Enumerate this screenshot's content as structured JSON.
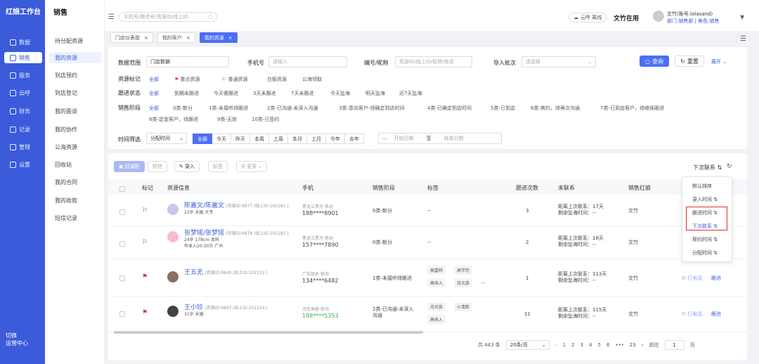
{
  "app": {
    "brand": "红娘工作台",
    "switch_label": "切换\n运营中心"
  },
  "leftnav": [
    {
      "label": "数据",
      "icon": "data-icon"
    },
    {
      "label": "销售",
      "icon": "sales-icon",
      "active": true
    },
    {
      "label": "服务",
      "icon": "service-icon"
    },
    {
      "label": "云呼",
      "icon": "cloud-call-icon"
    },
    {
      "label": "财务",
      "icon": "finance-icon"
    },
    {
      "label": "记录",
      "icon": "record-icon"
    },
    {
      "label": "管理",
      "icon": "manage-icon"
    },
    {
      "label": "设置",
      "icon": "settings-icon"
    }
  ],
  "subnav": {
    "title": "销售",
    "items": [
      "待分配资源",
      "我的资源",
      "到店预约",
      "到店登记",
      "我的面谈",
      "我的协作",
      "公海资源",
      "回收站",
      "我的合同",
      "我的收款",
      "短信记录"
    ],
    "active_index": 1
  },
  "topbar": {
    "search_placeholder": "手机号/微信号/资源ID/线上ID",
    "cloud_label": "云呼 离线",
    "status": "文竹在用",
    "user_name": "文竹(账号:lalasand)",
    "user_dept": "部门:销售部 | 角色:销售"
  },
  "tabs": [
    {
      "label": "门店仪表盘"
    },
    {
      "label": "我的客户"
    },
    {
      "label": "我的资源",
      "active": true
    }
  ],
  "filters": {
    "range_label": "数据范围",
    "range_value": "门店数据",
    "phone_label": "手机号",
    "phone_placeholder": "请输入",
    "code_label": "编号/昵称",
    "code_placeholder": "资源ID/线上ID/昵称/姓名",
    "batch_label": "导入批次",
    "batch_placeholder": "请选择",
    "query_label": "查询",
    "reset_label": "重置",
    "expand_label": "展开",
    "mark_label": "资源标记",
    "mark_options": [
      "全部",
      "重点资源",
      "普通资源",
      "白板资源",
      "公海领取"
    ],
    "follow_label": "跟进状态",
    "follow_options": [
      "全部",
      "到期未跟进",
      "今天需跟进",
      "3天未跟进",
      "7天未跟进",
      "今天坠海",
      "明天坠海",
      "近7天坠海"
    ],
    "stage_label": "销售阶段",
    "stage_options_row1": [
      "全部",
      "0类-新分",
      "1类-未接听待跟进",
      "2类-已沟通-未深入沟通",
      "3类-意向客户-待确定到店时间",
      "4类-已确定到店时间",
      "5类-已到店",
      "6类-爽约，待再次沟通",
      "7类-已到店客户，待继续跟进"
    ],
    "stage_options_row2": [
      "8类-定金客户，待跟进",
      "9类-无效",
      "10类-已签约"
    ],
    "time_label": "时间筛选",
    "time_select": "分配时间",
    "time_options": [
      "全部",
      "今天",
      "昨天",
      "本周",
      "上周",
      "本月",
      "上月",
      "今年",
      "去年"
    ],
    "date_start": "开始日期",
    "date_to": "至",
    "date_end": "结束日期"
  },
  "actions": {
    "transfer": "回调配",
    "sms": "短信",
    "entry": "录入",
    "tag": "标签",
    "more": "更多",
    "sort_label": "下次联系"
  },
  "columns": [
    "标记",
    "资源信息",
    "手机",
    "销售阶段",
    "标签",
    "跟进次数",
    "未联系",
    "销售红娘"
  ],
  "rows": [
    {
      "name": "陈嘉文/陈嘉文",
      "id": "(资源ID:9877 /线上ID:202281 )",
      "info": "22岁 未婚 大专",
      "loc": "黑龙江黑河 移动",
      "phone": "188****8901",
      "stage": "0类-新分",
      "tags": [
        "--"
      ],
      "count": "3",
      "last": "距离上次联系：17天",
      "left": "剩余坠海时间：--",
      "owner": "文竹",
      "flag": "outline"
    },
    {
      "name": "张梦瑶/张梦瑶",
      "id": "(资源ID:9878 /线上ID:202285 )",
      "info": "24岁 178cm 本科",
      "info2": "年收入20-30万 广州",
      "loc": "黑龙江黑河 移动",
      "phone": "157****7890",
      "stage": "0类-新分",
      "tags": [
        "--"
      ],
      "count": "2",
      "last": "距离上次联系：18天",
      "left": "剩余坠海时间：--",
      "owner": "文竹",
      "flag": "outline"
    },
    {
      "name": "王五无",
      "id": "(资源ID:9840 /线上ID:202215 )",
      "loc": "广东韶关 移动",
      "phone": "134****6482",
      "stage": "1类-未接听待跟进",
      "tags": [
        "高富帅",
        "高学历",
        "高收入",
        "月光族",
        "..."
      ],
      "count": "1",
      "last": "距离上次联系：113天",
      "left": "剩余坠海时间：--",
      "owner": "文竹",
      "flag": "red",
      "call": "打电话",
      "follow": "跟进"
    },
    {
      "name": "王小珍",
      "id": "(资源ID:9843 /线上ID:202224 )",
      "info": "31岁 未婚",
      "loc": "河北承德 移动",
      "phone": "188****5353",
      "stage": "2类-已沟通-未深入沟通",
      "tags": [
        "月光族",
        "小清新",
        "高收入"
      ],
      "count": "11",
      "last": "距离上次联系：115天",
      "left": "剩余坠海时间：--",
      "owner": "文竹",
      "flag": "red",
      "call": "打电话",
      "follow": "跟进"
    }
  ],
  "sort_dropdown": [
    "默认排序",
    "录入时间",
    "跟进时间",
    "下次联系",
    "帮约时间",
    "分配时间"
  ],
  "pager": {
    "total": "共 443 条",
    "page_size": "20条/页",
    "pages": [
      "1",
      "2",
      "3",
      "4",
      "5",
      "6",
      "•••",
      "23"
    ],
    "goto": "前往",
    "page": "1",
    "unit": "页"
  },
  "colors": {
    "brand": "#3b5bdb",
    "primary": "#4c6ef5",
    "red": "#e03131"
  }
}
